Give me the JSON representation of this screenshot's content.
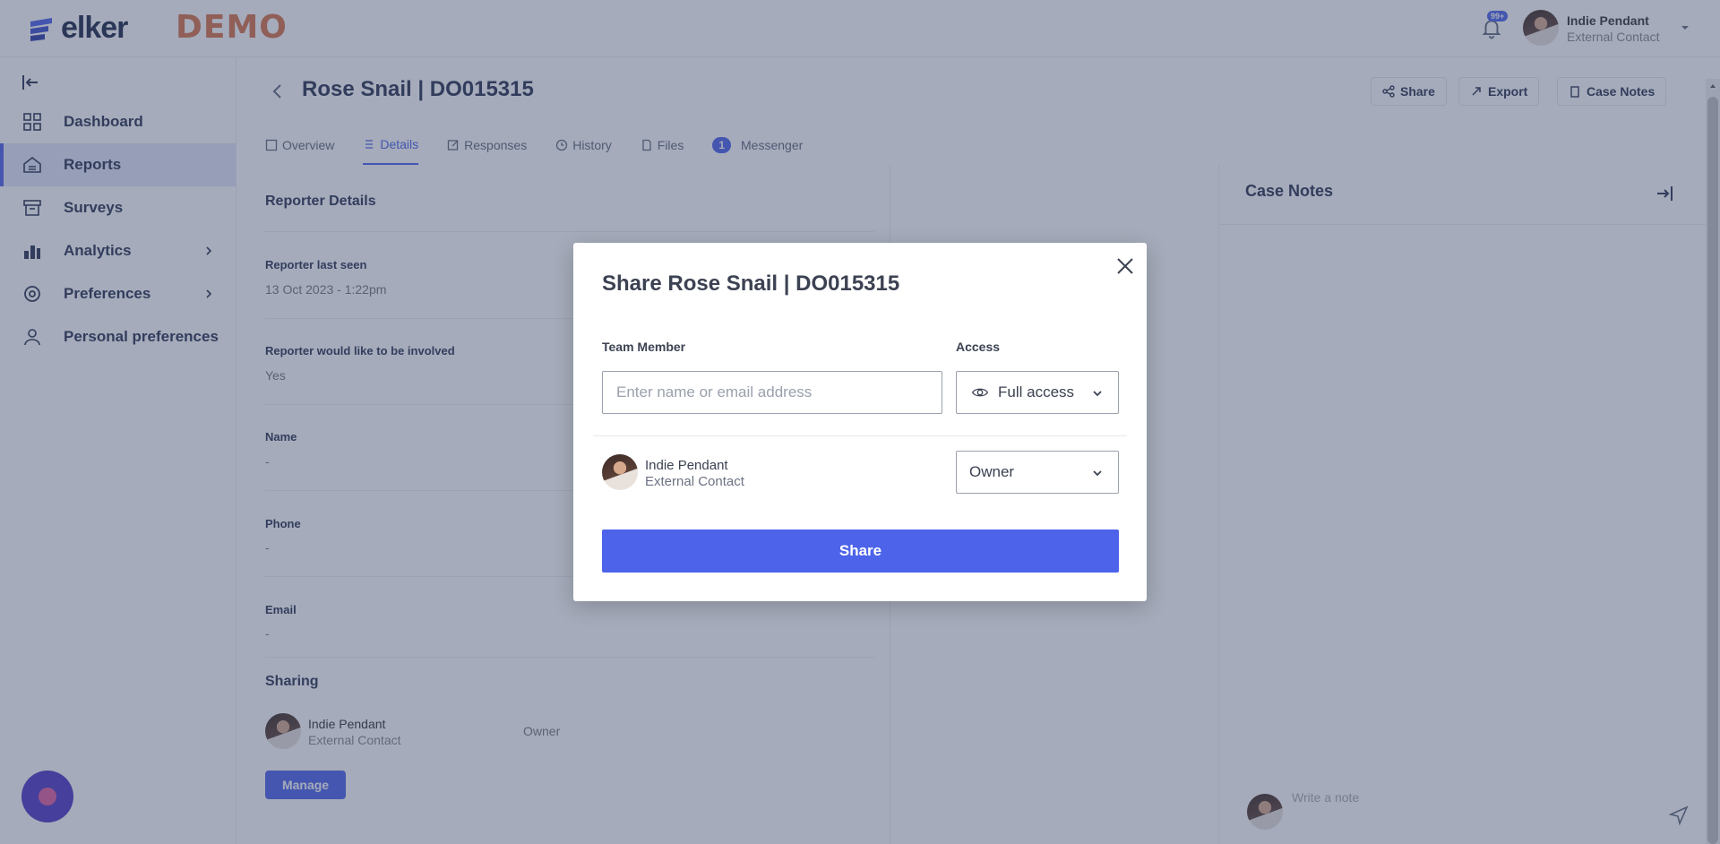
{
  "app": {
    "logo_text": "elker",
    "demo_label": "DEMO",
    "notification_badge": "99+"
  },
  "user": {
    "name": "Indie Pendant",
    "role": "External Contact"
  },
  "sidebar": {
    "items": [
      {
        "label": "Dashboard",
        "icon": "dashboard-icon"
      },
      {
        "label": "Reports",
        "icon": "reports-icon",
        "active": true
      },
      {
        "label": "Surveys",
        "icon": "surveys-icon"
      },
      {
        "label": "Analytics",
        "icon": "analytics-icon",
        "has_submenu": true
      },
      {
        "label": "Preferences",
        "icon": "preferences-icon",
        "has_submenu": true
      },
      {
        "label": "Personal preferences",
        "icon": "person-icon"
      }
    ]
  },
  "case": {
    "title": "Rose Snail | DO015315",
    "actions": {
      "share": "Share",
      "export": "Export",
      "case_notes": "Case Notes"
    },
    "tabs": [
      {
        "label": "Overview"
      },
      {
        "label": "Details",
        "active": true
      },
      {
        "label": "Responses"
      },
      {
        "label": "History"
      },
      {
        "label": "Files"
      },
      {
        "label": "Messenger",
        "badge": "1"
      }
    ]
  },
  "details": {
    "section_title": "Reporter Details",
    "fields": [
      {
        "label": "Reporter last seen",
        "value": "13 Oct 2023 - 1:22pm"
      },
      {
        "label": "Reporter would like to be involved",
        "value": "Yes"
      },
      {
        "label": "Name",
        "value": "-"
      },
      {
        "label": "Phone",
        "value": "-"
      },
      {
        "label": "Email",
        "value": "-"
      }
    ],
    "sharing": {
      "title": "Sharing",
      "user_name": "Indie Pendant",
      "user_role": "External Contact",
      "access": "Owner",
      "manage_label": "Manage"
    }
  },
  "notes": {
    "title": "Case Notes",
    "placeholder": "Write a note"
  },
  "modal": {
    "title": "Share Rose Snail | DO015315",
    "team_member_label": "Team Member",
    "access_label": "Access",
    "input_placeholder": "Enter name or email address",
    "access_value": "Full access",
    "member": {
      "name": "Indie Pendant",
      "role": "External Contact",
      "access": "Owner"
    },
    "share_button": "Share"
  },
  "colors": {
    "accent": "#4d63ea",
    "overlay": "rgba(58,72,104,0.46)",
    "demo": "#d9744a",
    "chat_bubble": "#5038c6"
  }
}
